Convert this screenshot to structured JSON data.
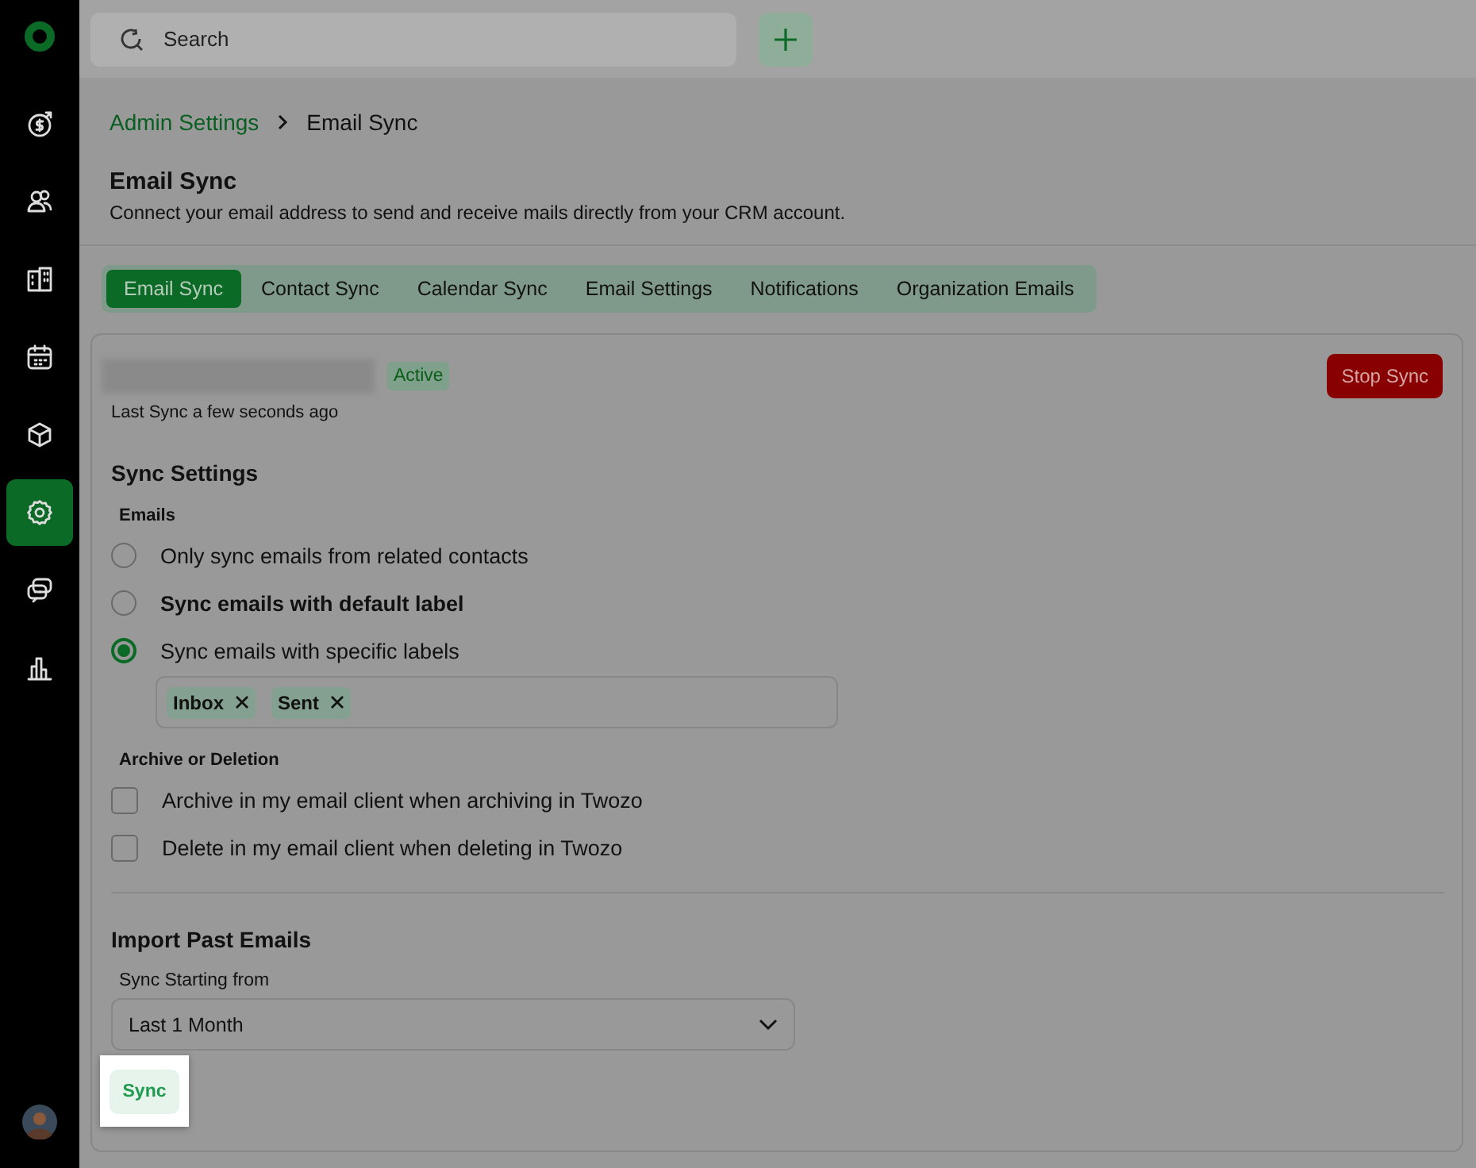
{
  "sidebar": {
    "items": [
      {
        "kind": "deals",
        "selected": false
      },
      {
        "kind": "contacts",
        "selected": false
      },
      {
        "kind": "companies",
        "selected": false
      },
      {
        "kind": "calendar",
        "selected": false
      },
      {
        "kind": "products",
        "selected": false
      },
      {
        "kind": "settings",
        "selected": true
      },
      {
        "kind": "chat",
        "selected": false
      },
      {
        "kind": "reports",
        "selected": false
      }
    ]
  },
  "search": {
    "placeholder": "Search"
  },
  "breadcrumb": [
    {
      "text": "Admin Settings",
      "kind": "link"
    },
    {
      "text": "Email Sync",
      "kind": "current"
    }
  ],
  "title": "Email Sync",
  "subtitle": "Connect your email address to send and receive mails directly from your CRM account.",
  "tabs": [
    {
      "label": "Email Sync",
      "selected": true
    },
    {
      "label": "Contact Sync",
      "selected": false
    },
    {
      "label": "Calendar Sync",
      "selected": false
    },
    {
      "label": "Email Settings",
      "selected": false
    },
    {
      "label": "Notifications",
      "selected": false
    },
    {
      "label": "Organization Emails",
      "selected": false
    }
  ],
  "account": {
    "status": "Active",
    "last_sync": "Last Sync a few seconds ago",
    "stop_button": "Stop Sync"
  },
  "sync_settings": {
    "heading": "Sync Settings",
    "group_label": "Emails",
    "options": [
      {
        "label": "Only sync emails from related contacts",
        "selected": false,
        "bold": false
      },
      {
        "label": "Sync emails with default label",
        "selected": false,
        "bold": true
      },
      {
        "label": "Sync emails with specific labels",
        "selected": true,
        "bold": false
      }
    ],
    "labels": [
      "Inbox",
      "Sent"
    ]
  },
  "archive": {
    "group_label": "Archive or Deletion",
    "options": [
      {
        "label": "Archive in my email client when archiving in Twozo",
        "checked": false
      },
      {
        "label": "Delete in my email client when deleting in Twozo",
        "checked": false
      }
    ]
  },
  "import": {
    "heading": "Import Past Emails",
    "field_label": "Sync Starting from",
    "value": "Last 1 Month",
    "button": "Sync",
    "highlighted": true
  }
}
